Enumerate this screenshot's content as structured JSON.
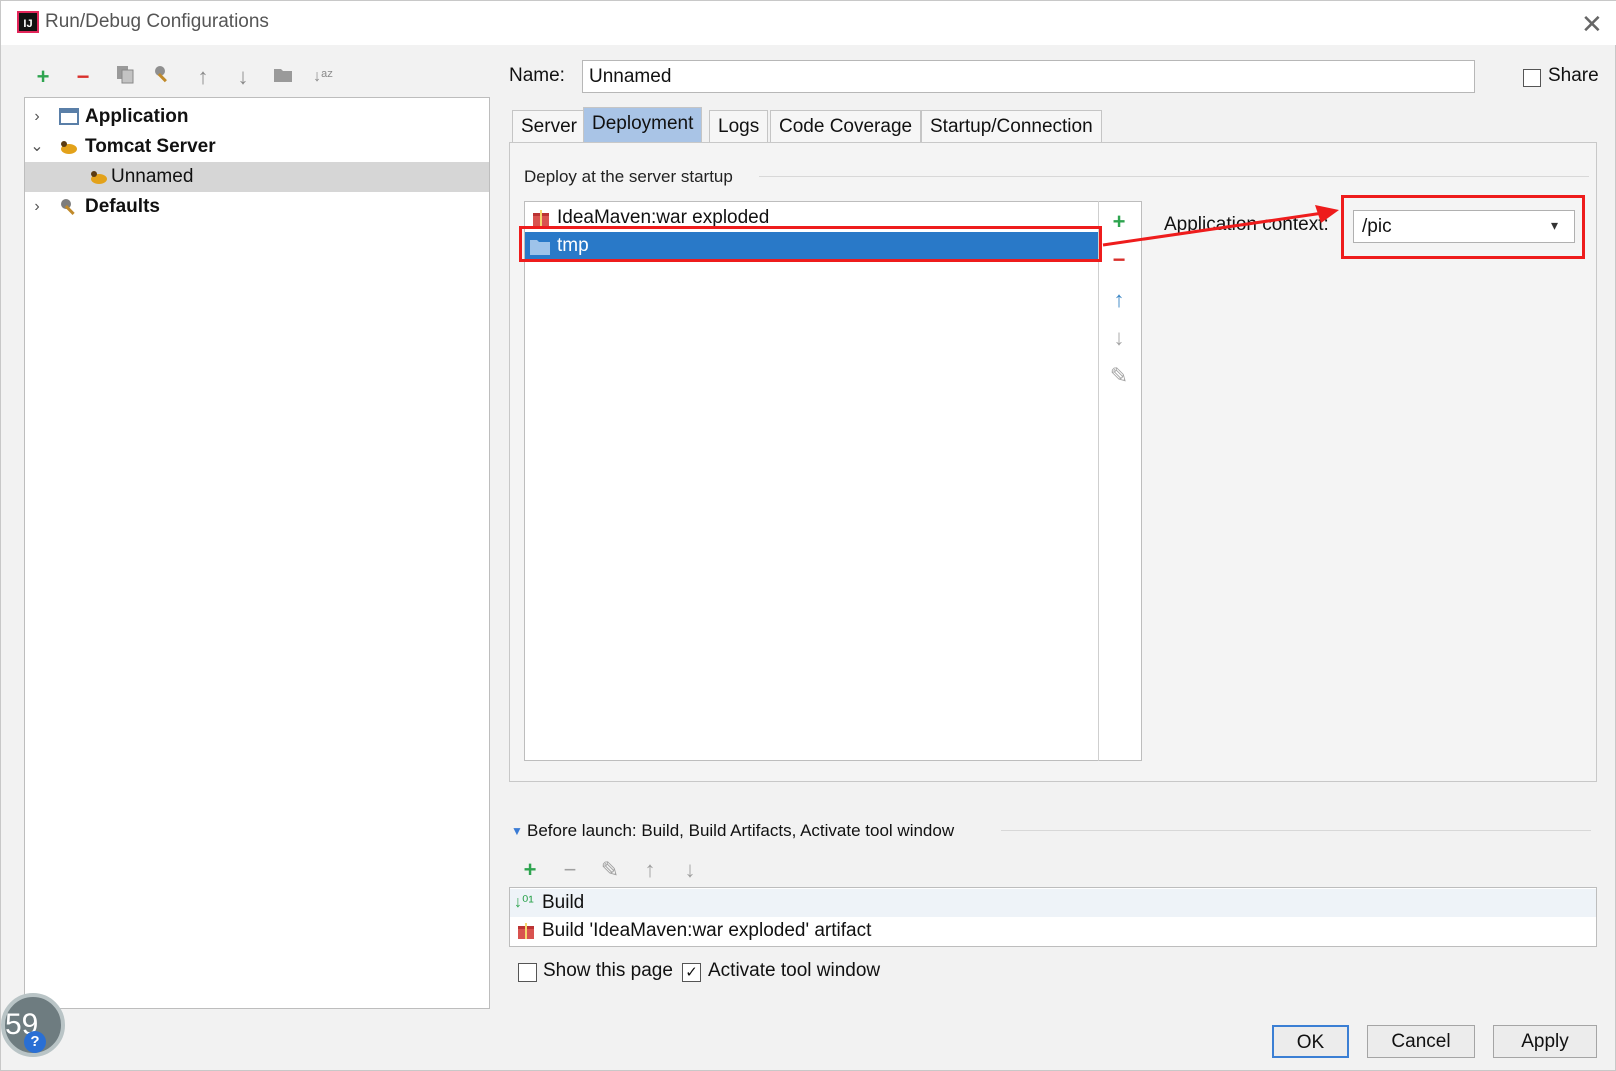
{
  "window": {
    "title": "Run/Debug Configurations",
    "app_icon": "IJ",
    "close": "✕"
  },
  "toolbar": {
    "icons": [
      "add-icon",
      "remove-icon",
      "copy-icon",
      "edit-defaults-icon",
      "move-up-icon",
      "move-down-icon",
      "folder-icon",
      "sort-icon"
    ]
  },
  "tree": {
    "items": [
      {
        "label": "Application",
        "chevron": "›"
      },
      {
        "label": "Tomcat Server",
        "chevron": "⌄"
      },
      {
        "label": "Unnamed"
      },
      {
        "label": "Defaults",
        "chevron": "›"
      }
    ]
  },
  "config": {
    "name_label": "Name:",
    "name_value": "Unnamed",
    "share_label": "Share"
  },
  "tabs": [
    "Server",
    "Deployment",
    "Logs",
    "Code Coverage",
    "Startup/Connection"
  ],
  "deployment": {
    "section_label": "Deploy at the server startup",
    "items": [
      "IdeaMaven:war exploded",
      "tmp"
    ],
    "context_label": "Application context:",
    "context_value": "/pic"
  },
  "before_launch": {
    "label": "Before launch: Build, Build Artifacts, Activate tool window",
    "items": [
      "Build",
      "Build 'IdeaMaven:war exploded' artifact"
    ]
  },
  "options": {
    "show_page_label": "Show this page",
    "show_page_checked": false,
    "activate_label": "Activate tool window",
    "activate_checked": true,
    "check_mark": "✓"
  },
  "buttons": {
    "ok": "OK",
    "cancel": "Cancel",
    "apply": "Apply"
  },
  "overlay": {
    "badge_text": "59",
    "help_symbol": "?"
  },
  "colors": {
    "selection": "#2979c8",
    "annotation": "#ee1c1c",
    "add": "#2ea44f",
    "remove": "#d9302c"
  }
}
